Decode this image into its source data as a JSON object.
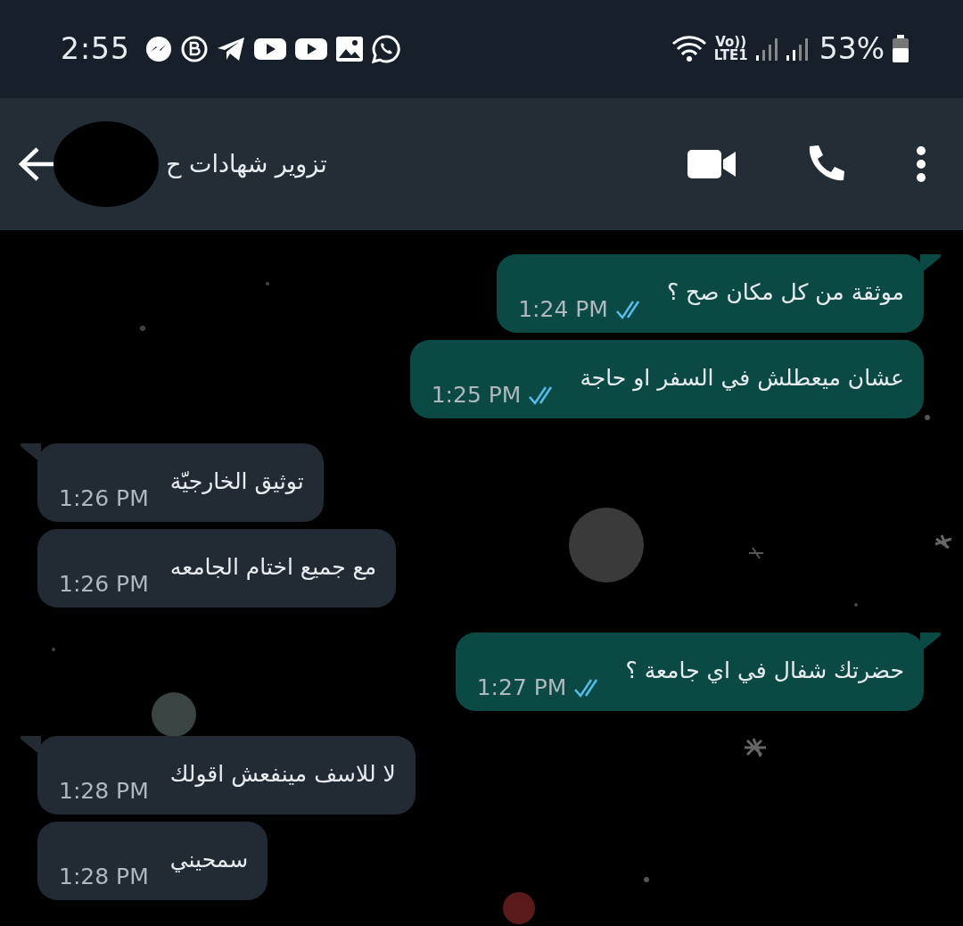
{
  "status_bar": {
    "time": "2:55",
    "volte": "Vo))",
    "network": "LTE1",
    "battery": "53%"
  },
  "header": {
    "contact_name": "تزوير شهادات ح"
  },
  "messages": [
    {
      "kind": "out",
      "text": "موثقة من كل مكان صح ؟",
      "time": "1:24 PM",
      "read": true,
      "tail": true
    },
    {
      "kind": "out",
      "text": "عشان ميعطلش في السفر او حاجة",
      "time": "1:25 PM",
      "read": true,
      "tail": false
    },
    {
      "kind": "in",
      "text": "توثيق الخارجيّة",
      "time": "1:26 PM",
      "tail": true
    },
    {
      "kind": "in",
      "text": "مع جميع اختام الجامعه",
      "time": "1:26 PM",
      "tail": false
    },
    {
      "kind": "out",
      "text": "حضرتك شفال في اي جامعة ؟",
      "time": "1:27 PM",
      "read": true,
      "tail": true
    },
    {
      "kind": "in",
      "text": "لا للاسف مينفعش اقولك",
      "time": "1:28 PM",
      "tail": true
    },
    {
      "kind": "in",
      "text": "سمحيني",
      "time": "1:28 PM",
      "tail": false
    }
  ]
}
